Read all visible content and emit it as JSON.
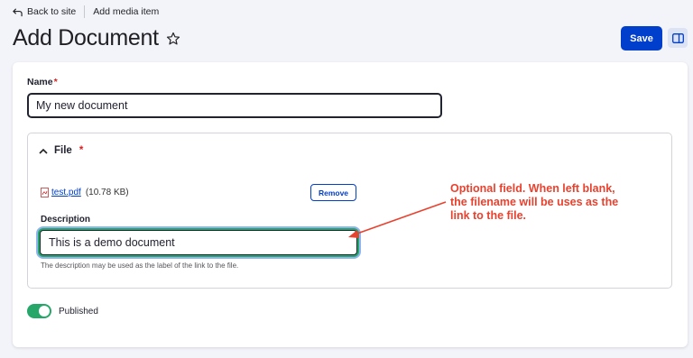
{
  "breadcrumb": {
    "back_label": "Back to site",
    "current_label": "Add media item"
  },
  "header": {
    "title": "Add Document",
    "save_label": "Save"
  },
  "form": {
    "name_label": "Name",
    "required_marker": "*",
    "name_value": "My new document",
    "file": {
      "section_label": "File",
      "file_name": "test.pdf",
      "file_size": "(10.78 KB)",
      "remove_label": "Remove",
      "description_label": "Description",
      "description_value": "This is a demo document",
      "description_help": "The description may be used as the label of the link to the file."
    },
    "published_label": "Published",
    "published_on": true
  },
  "annotation": {
    "text": "Optional field.  When left blank, the filename will be uses as the link to the file.",
    "color": "#e8422f"
  },
  "colors": {
    "accent": "#003ecc",
    "toggle_on": "#26a769",
    "required": "#d72222"
  },
  "icons": [
    "back-arrow-icon",
    "star-icon",
    "sidebar-panel-icon",
    "chevron-up-icon",
    "pdf-file-icon"
  ]
}
